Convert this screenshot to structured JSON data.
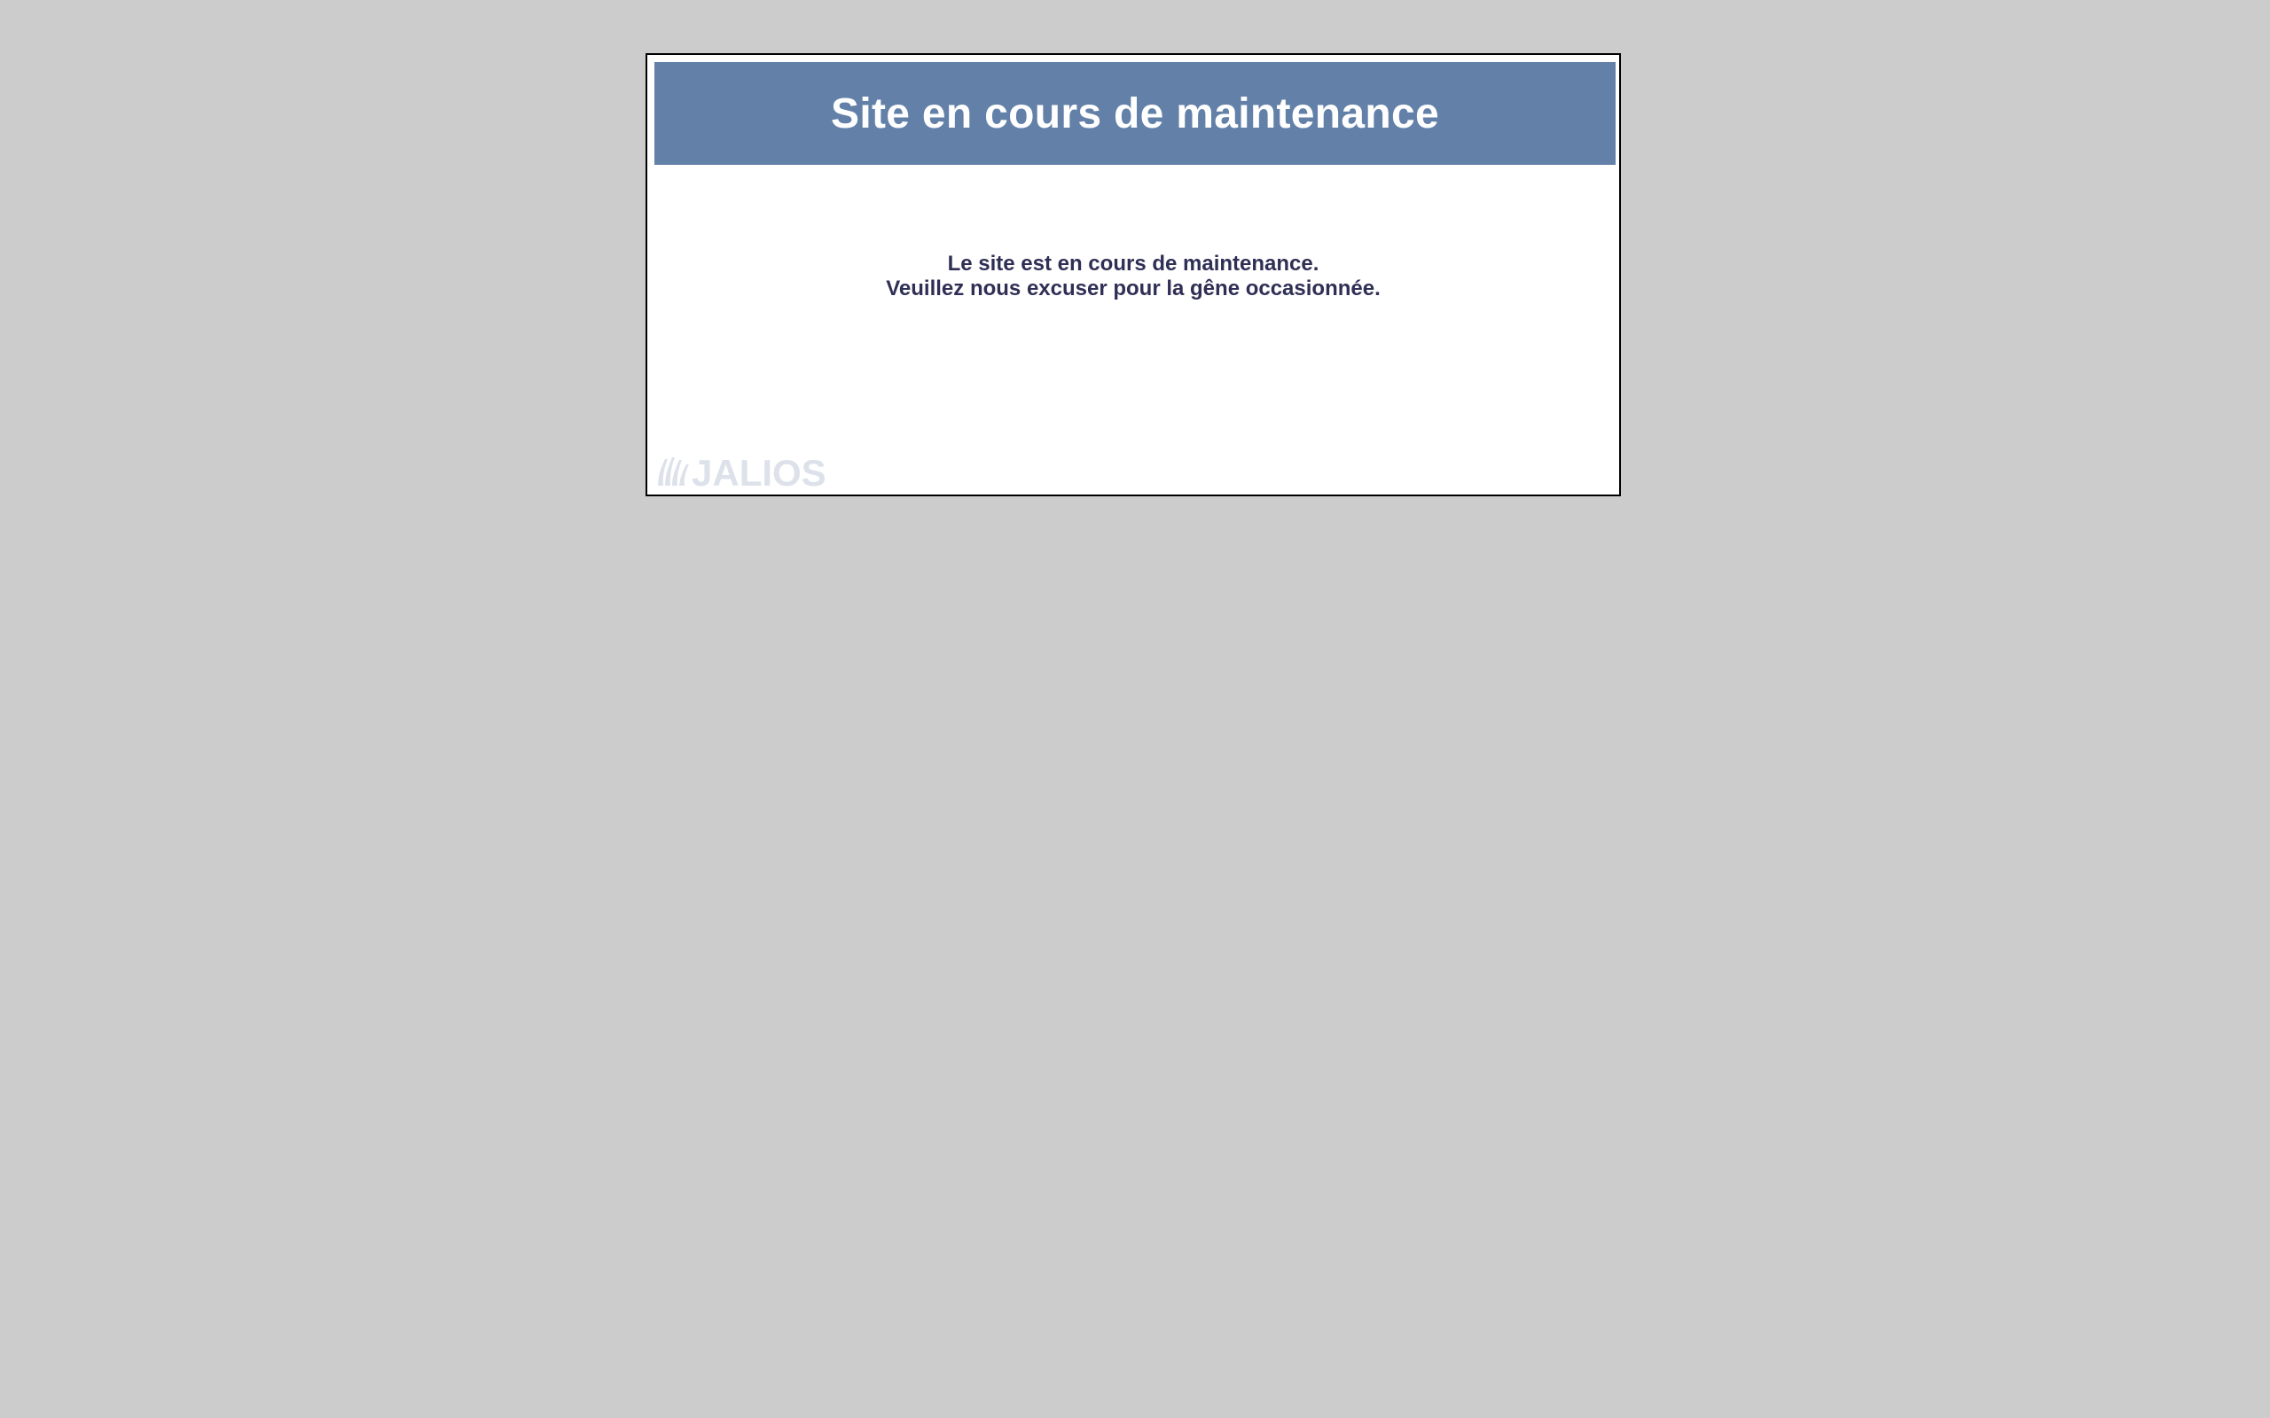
{
  "page": {
    "title": "Site en cours de maintenance",
    "message_lines": [
      "Le site est en cours de maintenance.",
      "Veuillez nous excuser pour la gêne occasionnée."
    ]
  },
  "logo": {
    "text": "JALIOS",
    "icon": "jalios-logo-icon"
  },
  "colors": {
    "background": "#cccccc",
    "header": "#6381a8",
    "title_text": "#ffffff",
    "message_text": "#2f2f55",
    "logo": "#dde2ea"
  }
}
